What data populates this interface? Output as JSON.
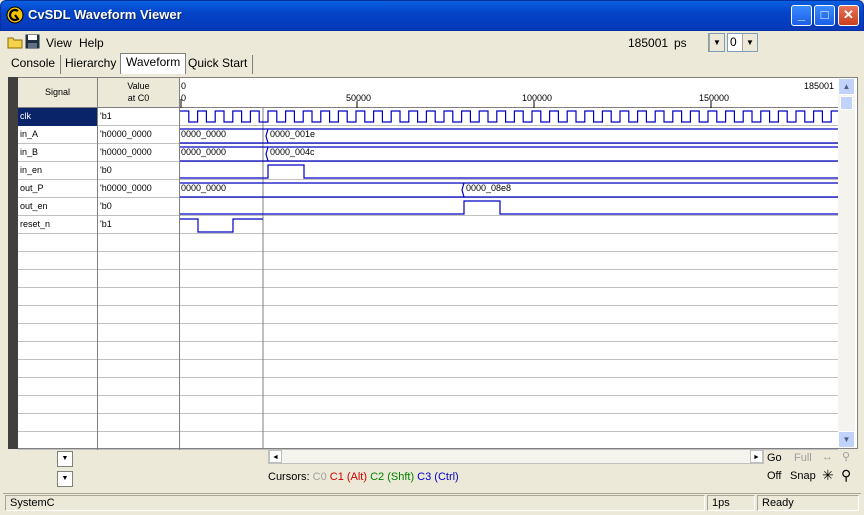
{
  "window": {
    "title": "CvSDL Waveform Viewer"
  },
  "menu": {
    "view": "View",
    "help": "Help"
  },
  "toolbar": {
    "time_value": "185001",
    "time_unit": "ps",
    "zoom_value": "0"
  },
  "tabs": [
    "Console",
    "Hierarchy",
    "Waveform",
    "Quick Start"
  ],
  "grid": {
    "signal_header": "Signal",
    "value_header_1": "Value",
    "value_header_2": "at C0",
    "ruler_start": "0",
    "ruler_end": "185001",
    "ruler_ticks": [
      "0",
      "50000",
      "100000",
      "150000"
    ],
    "signals": [
      {
        "name": "clk",
        "value": "'b1"
      },
      {
        "name": "in_A",
        "value": "'h0000_0000"
      },
      {
        "name": "in_B",
        "value": "'h0000_0000"
      },
      {
        "name": "in_en",
        "value": "'b0"
      },
      {
        "name": "out_P",
        "value": "'h0000_0000"
      },
      {
        "name": "out_en",
        "value": "'b0"
      },
      {
        "name": "reset_n",
        "value": "'b1"
      }
    ],
    "bus_labels": {
      "in_A_1": "0000_0000",
      "in_A_2": "0000_001e",
      "in_B_1": "0000_0000",
      "in_B_2": "0000_004c",
      "out_P_1": "0000_0000",
      "out_P_2": "0000_08e8"
    }
  },
  "bottom": {
    "go": "Go",
    "full": "Full",
    "off": "Off",
    "snap": "Snap",
    "cursors_label": "Cursors:",
    "c0": "C0",
    "c1": "C1 (Alt)",
    "c2": "C2 (Shft)",
    "c3": "C3 (Ctrl)"
  },
  "status": {
    "left": "SystemC",
    "resolution": "1ps",
    "state": "Ready"
  },
  "colors": {
    "wave": "#0000c0",
    "c1": "#cc0000",
    "c2": "#008000",
    "c3": "#0000cc"
  }
}
